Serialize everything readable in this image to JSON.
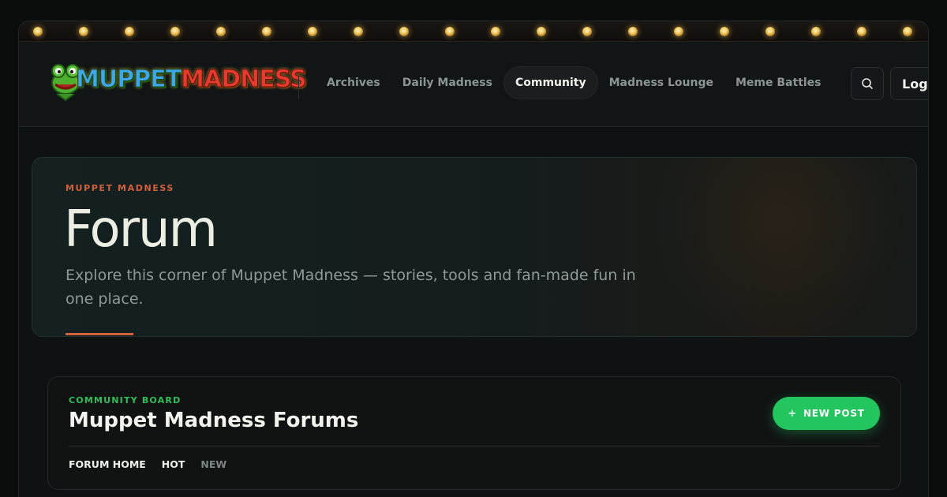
{
  "marquee": {
    "bulb_count": 20,
    "bulb_color": "#f2c75c"
  },
  "header": {
    "logo": {
      "word1": "MUPPET",
      "word2": "MADNESS",
      "mascot_icon": "frog-icon"
    },
    "nav": [
      {
        "label": "Archives",
        "active": false
      },
      {
        "label": "Daily Madness",
        "active": false
      },
      {
        "label": "Community",
        "active": true
      },
      {
        "label": "Madness Lounge",
        "active": false
      },
      {
        "label": "Meme Battles",
        "active": false
      }
    ],
    "search_icon": "search-icon",
    "login_label": "Login"
  },
  "hero": {
    "eyebrow": "MUPPET MADNESS",
    "title": "Forum",
    "subtitle": "Explore this corner of Muppet Madness — stories, tools and fan-made fun in one place.",
    "accent_color": "#d2603a"
  },
  "board": {
    "eyebrow": "COMMUNITY BOARD",
    "title": "Muppet Madness Forums",
    "new_post_label": "NEW POST",
    "new_post_icon": "plus-icon",
    "accent_color": "#22c55e",
    "tabs": [
      {
        "label": "FORUM HOME",
        "muted": false
      },
      {
        "label": "HOT",
        "muted": false
      },
      {
        "label": "NEW",
        "muted": true
      }
    ]
  }
}
